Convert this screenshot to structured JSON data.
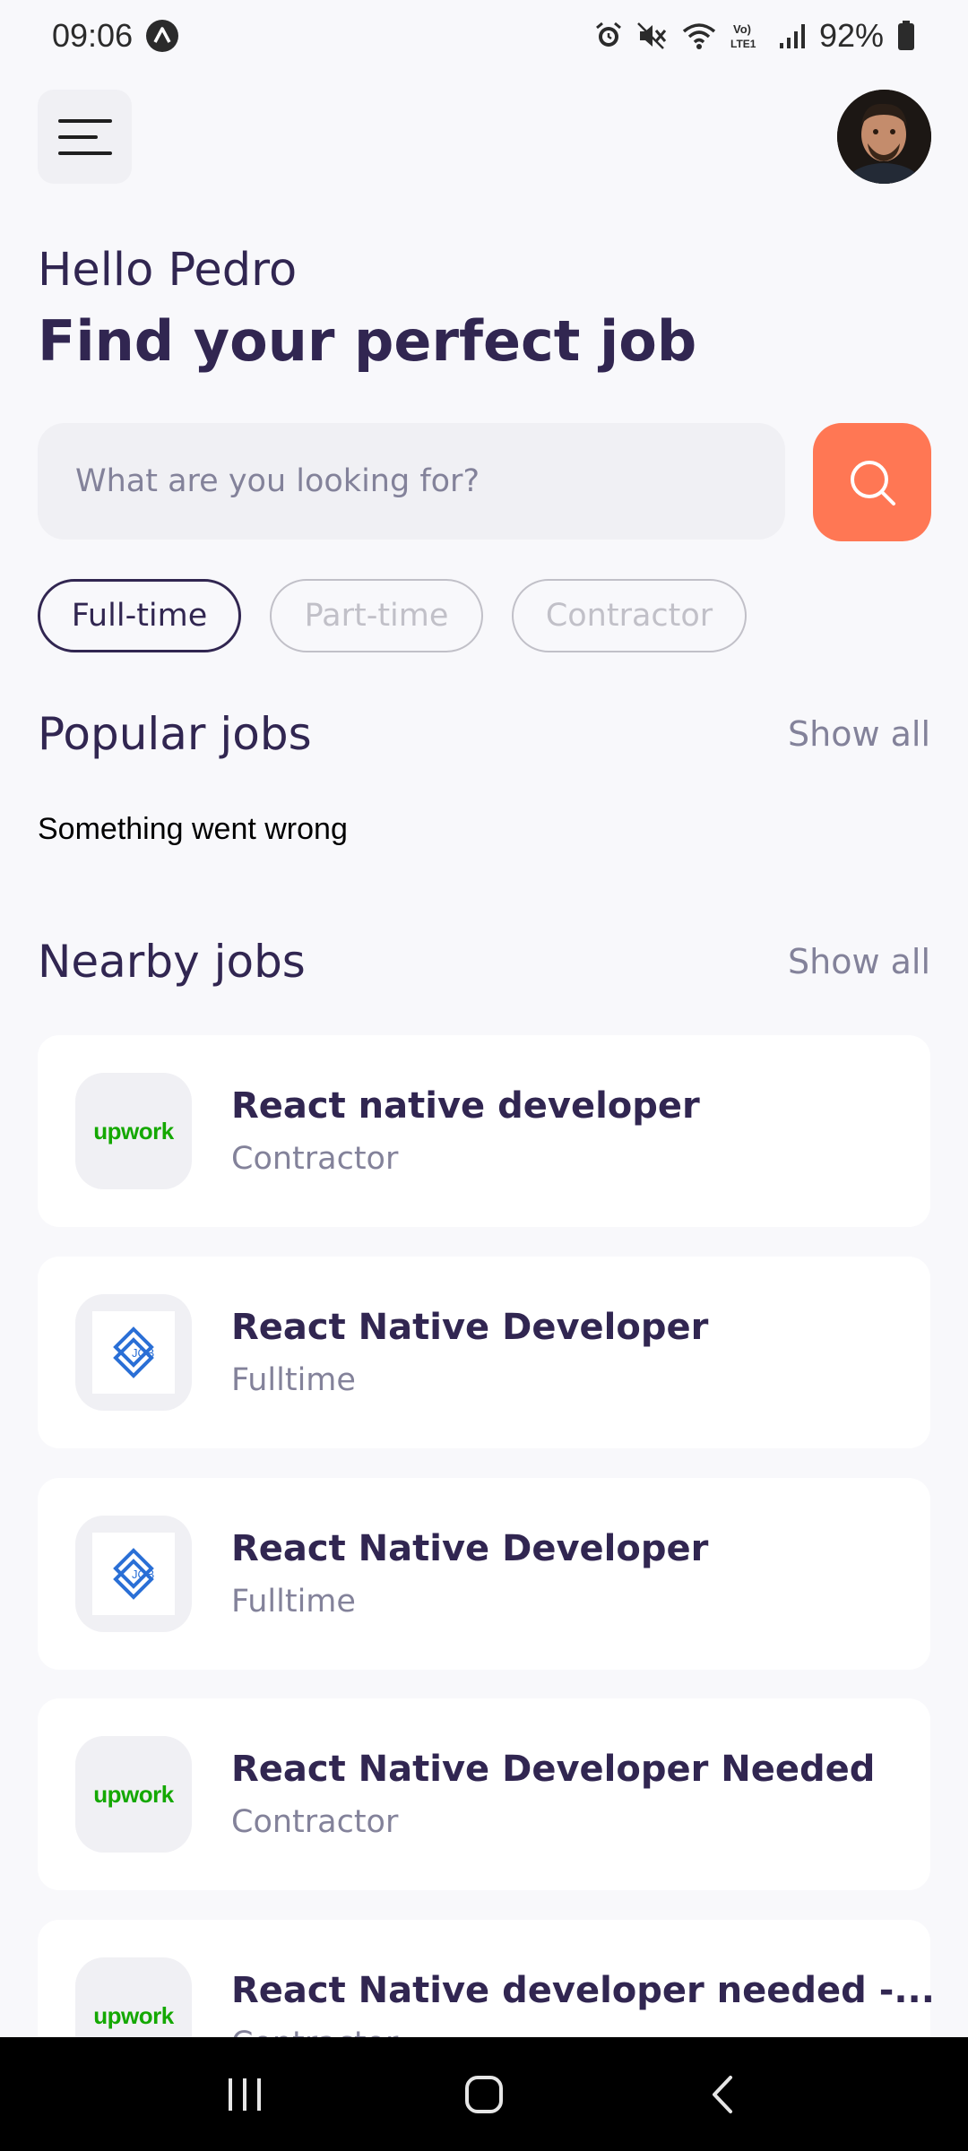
{
  "status_bar": {
    "time": "09:06",
    "battery": "92%"
  },
  "header": {
    "greeting": "Hello Pedro",
    "headline": "Find your perfect job"
  },
  "search": {
    "placeholder": "What are you looking for?"
  },
  "tabs": [
    {
      "label": "Full-time",
      "active": true
    },
    {
      "label": "Part-time",
      "active": false
    },
    {
      "label": "Contractor",
      "active": false
    }
  ],
  "popular": {
    "title": "Popular jobs",
    "show_all": "Show all",
    "error": "Something went wrong"
  },
  "nearby": {
    "title": "Nearby jobs",
    "show_all": "Show all",
    "jobs": [
      {
        "title": "React native developer",
        "type": "Contractor",
        "logo": "upwork"
      },
      {
        "title": "React Native Developer",
        "type": "Fulltime",
        "logo": "job"
      },
      {
        "title": "React Native Developer",
        "type": "Fulltime",
        "logo": "job"
      },
      {
        "title": "React Native Developer Needed",
        "type": "Contractor",
        "logo": "upwork"
      },
      {
        "title": "React Native developer needed -...",
        "type": "Contractor",
        "logo": "upwork"
      }
    ]
  },
  "logos": {
    "upwork_text": "upwork",
    "job_text": "JOB"
  },
  "colors": {
    "primary": "#312651",
    "accent": "#FF7754",
    "gray": "#83829A",
    "upwork_green": "#14A800",
    "job_blue": "#2A6FD6"
  }
}
